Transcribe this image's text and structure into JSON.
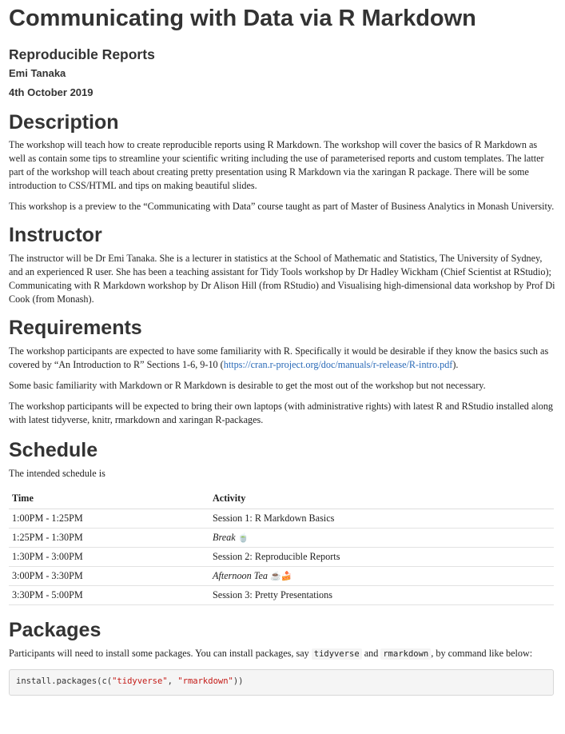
{
  "header": {
    "title": "Communicating with Data via R Markdown",
    "subtitle": "Reproducible Reports",
    "author": "Emi Tanaka",
    "date": "4th October 2019"
  },
  "description": {
    "heading": "Description",
    "p1": "The workshop will teach how to create reproducible reports using R Markdown. The workshop will cover the basics of R Markdown as well as contain some tips to streamline your scientific writing including the use of parameterised reports and custom templates. The latter part of the workshop will teach about creating pretty presentation using R Markdown via the xaringan R package. There will be some introduction to CSS/HTML and tips on making beautiful slides.",
    "p2": "This workshop is a preview to the “Communicating with Data” course taught as part of Master of Business Analytics in Monash University."
  },
  "instructor": {
    "heading": "Instructor",
    "p1": "The instructor will be Dr Emi Tanaka. She is a lecturer in statistics at the School of Mathematic and Statistics, The University of Sydney, and an experienced R user. She has been a teaching assistant for Tidy Tools workshop by Dr Hadley Wickham (Chief Scientist at RStudio); Communicating with R Markdown workshop by Dr Alison Hill (from RStudio) and Visualising high-dimensional data workshop by Prof Di Cook (from Monash)."
  },
  "requirements": {
    "heading": "Requirements",
    "p1_before": "The workshop participants are expected to have some familiarity with R. Specifically it would be desirable if they know the basics such as covered by “An Introduction to R” Sections 1-6, 9-10 (",
    "p1_link": "https://cran.r-project.org/doc/manuals/r-release/R-intro.pdf",
    "p1_after": ").",
    "p2": "Some basic familiarity with Markdown or R Markdown is desirable to get the most out of the workshop but not necessary.",
    "p3": "The workshop participants will be expected to bring their own laptops (with administrative rights) with latest R and RStudio installed along with latest tidyverse, knitr, rmarkdown and xaringan R-packages."
  },
  "schedule": {
    "heading": "Schedule",
    "intro": "The intended schedule is",
    "columns": [
      "Time",
      "Activity"
    ],
    "rows": [
      {
        "time": "1:00PM - 1:25PM",
        "activity": "Session 1: R Markdown Basics",
        "emoji": ""
      },
      {
        "time": "1:25PM - 1:30PM",
        "activity": "Break",
        "emoji": "🍵"
      },
      {
        "time": "1:30PM - 3:00PM",
        "activity": "Session 2: Reproducible Reports",
        "emoji": ""
      },
      {
        "time": "3:00PM - 3:30PM",
        "activity": "Afternoon Tea",
        "emoji": "☕🍰"
      },
      {
        "time": "3:30PM - 5:00PM",
        "activity": "Session 3: Pretty Presentations",
        "emoji": ""
      }
    ]
  },
  "packages": {
    "heading": "Packages",
    "p1_before": "Participants will need to install some packages. You can install packages, say ",
    "code1": "tidyverse",
    "p1_mid": " and ",
    "code2": "rmarkdown",
    "p1_after": ", by command like below:",
    "code_fn": "install.packages(c(",
    "code_arg1": "\"tidyverse\"",
    "code_sep": ", ",
    "code_arg2": "\"rmarkdown\"",
    "code_end": "))"
  }
}
